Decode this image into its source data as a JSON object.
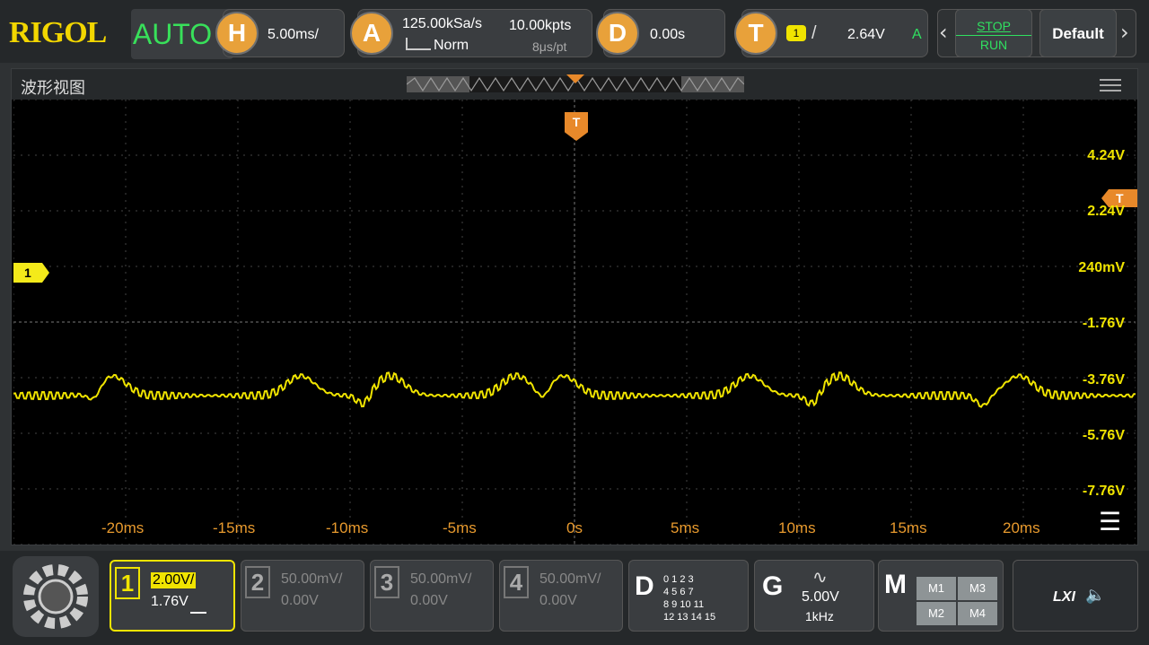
{
  "brand": "RIGOL",
  "mode": "AUTO",
  "horizontal": {
    "letter": "H",
    "timebase": "5.00ms/"
  },
  "acquire": {
    "letter": "A",
    "sample_rate": "125.00kSa/s",
    "mem_depth": "10.00kpts",
    "mode": "Norm",
    "sample_interval": "8μs/pt"
  },
  "delay": {
    "letter": "D",
    "value": "0.00s"
  },
  "trigger": {
    "letter": "T",
    "channel": "1",
    "level": "2.64V",
    "mode": "A"
  },
  "stop_label": "STOP",
  "run_label": "RUN",
  "default_label": "Default",
  "panel_title": "波形视图",
  "trigger_marker": "T",
  "channel_marker": "1",
  "y_labels": [
    "4.24V",
    "2.24V",
    "240mV",
    "-1.76V",
    "-3.76V",
    "-5.76V",
    "-7.76V"
  ],
  "x_labels": [
    "-20ms",
    "-15ms",
    "-10ms",
    "-5ms",
    "0s",
    "5ms",
    "10ms",
    "15ms",
    "20ms"
  ],
  "channels": [
    {
      "num": "1",
      "scale": "2.00V/",
      "offset": "1.76V",
      "active": true
    },
    {
      "num": "2",
      "scale": "50.00mV/",
      "offset": "0.00V",
      "active": false
    },
    {
      "num": "3",
      "scale": "50.00mV/",
      "offset": "0.00V",
      "active": false
    },
    {
      "num": "4",
      "scale": "50.00mV/",
      "offset": "0.00V",
      "active": false
    }
  ],
  "digital": {
    "letter": "D",
    "rows": [
      "0 1 2 3",
      "4 5 6 7",
      "8 9 10 11",
      "12 13 14 15"
    ]
  },
  "generator": {
    "letter": "G",
    "amplitude": "5.00V",
    "frequency": "1kHz"
  },
  "math": {
    "letter": "M",
    "items": [
      "M1",
      "M3",
      "M2",
      "M4"
    ]
  },
  "lxi": "LXI",
  "colors": {
    "ch1": "#f0e400",
    "trigger": "#e8892a",
    "run": "#30e060"
  }
}
